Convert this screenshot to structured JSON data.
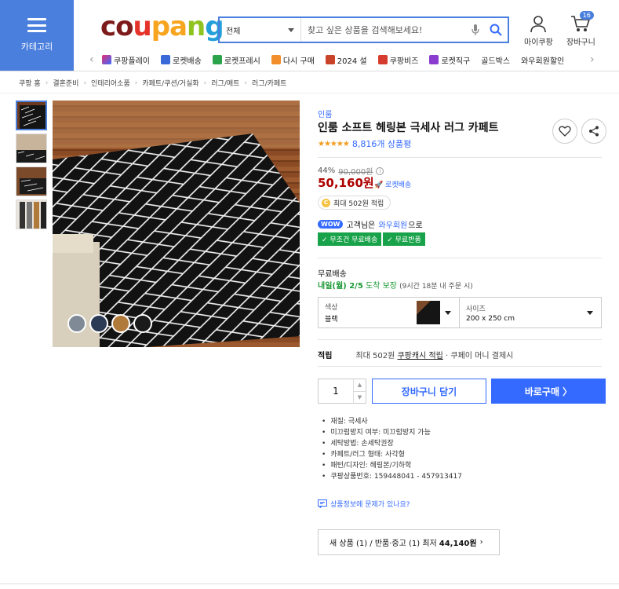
{
  "header": {
    "category_label": "카테고리",
    "logo": [
      "co",
      "u",
      "pa",
      "n",
      "g",
      ""
    ],
    "search": {
      "scope": "전체",
      "placeholder": "찾고 싶은 상품을 검색해보세요!"
    },
    "mypage_label": "마이쿠팡",
    "cart_label": "장바구니",
    "cart_count": "16",
    "quick_links": [
      "쿠팡플레이",
      "로켓배송",
      "로켓프레시",
      "다시 구매",
      "2024 설",
      "쿠팡비즈",
      "로켓직구",
      "골드박스",
      "와우회원할인"
    ]
  },
  "breadcrumb": [
    "쿠팡 홈",
    "결혼준비",
    "인테리어소품",
    "카페트/쿠션/거실화",
    "러그/매트",
    "러그/카페트"
  ],
  "product": {
    "brand": "인룸",
    "title": "인룸 소프트 헤링본 극세사 러그 카페트",
    "stars": "★★★★★",
    "rating": 5,
    "review_count": "8,816개 상품평",
    "discount_rate": "44%",
    "original_price": "90,000원",
    "price": "50,160원",
    "rocket_label": "로켓배송",
    "points_label": "최대 502원 적립",
    "wow_badge": "WOW",
    "wow_text_1": "고객님은",
    "wow_text_2": "와우회원",
    "wow_text_3": "으로",
    "badge_free_ship": "✓ 무조건 무료배송",
    "badge_free_return": "✓ 무료반품",
    "shipping_title": "무료배송",
    "shipping_date": "내일(월) 2/5",
    "shipping_guarantee": "도착 보장",
    "shipping_note": "(9시간 18분 내 주문 시)",
    "option_color_label": "색상",
    "option_color_value": "블랙",
    "option_size_label": "사이즈",
    "option_size_value": "200 x 250 cm",
    "reward_label": "적립",
    "reward_value_1": "최대 502원",
    "reward_value_link": "쿠팡캐시 적립",
    "reward_value_2": "· 쿠페이 머니 결제시",
    "quantity": "1",
    "cart_button": "장바구니 담기",
    "buy_button": "바로구매 〉",
    "specs": [
      "재질: 극세사",
      "미끄럼방지 여부: 미끄럼방지 가능",
      "세탁방법: 손세탁권장",
      "카페트/러그 형태: 사각형",
      "패턴/디자인: 헤링본/기하학",
      "쿠팡상품번호: 159448041 - 457913417"
    ],
    "inquiry": "상품정보에 문제가 있나요?",
    "other_sellers_1": "새 상품 (1) / 반품·중고 (1) 최저",
    "other_sellers_price": "44,140원",
    "other_sellers_arrow": "›"
  },
  "colors": {
    "accent": "#346aff",
    "category_bg": "#4a7fdd",
    "price_red": "#ae0000",
    "green": "#18a249",
    "star": "#f29b1e"
  }
}
